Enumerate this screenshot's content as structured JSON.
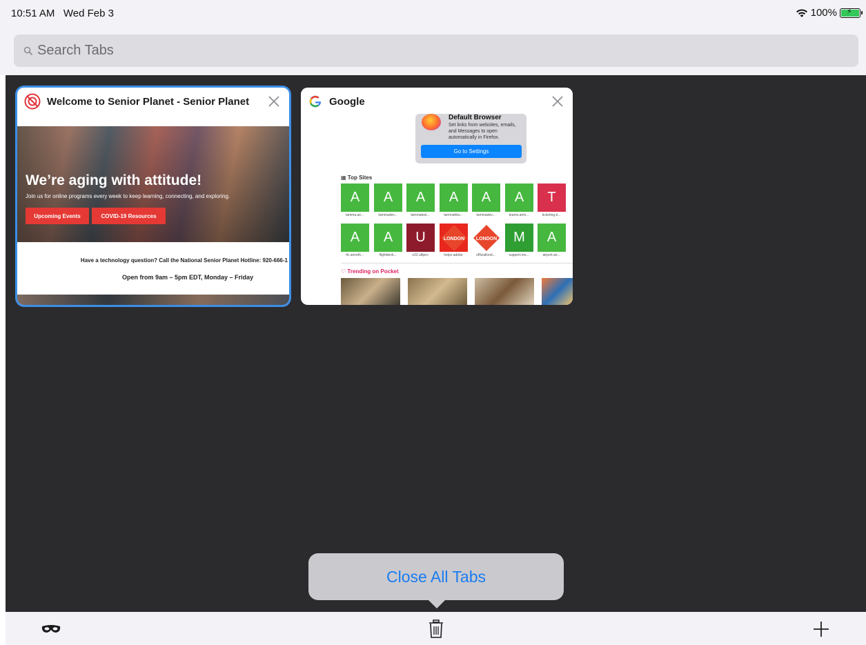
{
  "status": {
    "time": "10:51 AM",
    "date": "Wed Feb 3",
    "battery": "100%",
    "battery_level": 1.0
  },
  "search": {
    "placeholder": "Search Tabs"
  },
  "tabs": [
    {
      "title": "Welcome to Senior Planet - Senior Planet",
      "selected": true,
      "icon": "senior-planet-logo",
      "preview": {
        "headline": "We’re aging with attitude!",
        "subtitle": "Join us for online programs every week to keep learning, connecting, and exploring.",
        "button_events": "Upcoming Events",
        "button_covid": "COVID-19 Resources",
        "hotline": "Have a technology question? Call the National Senior Planet Hotline: 920-666-1",
        "hours": "Open from 9am – 5pm EDT, Monday – Friday"
      }
    },
    {
      "title": "Google",
      "selected": false,
      "icon": "google-g-logo",
      "preview": {
        "promo_title": "Default Browser",
        "promo_text": "Set links from websites, emails, and Messages to open automatically in Firefox.",
        "promo_button": "Go to Settings",
        "top_sites_label": "Top Sites",
        "top_sites": [
          {
            "letter": "A",
            "label": "tamma.air...",
            "color": "#46b83f"
          },
          {
            "letter": "A",
            "label": "tammadev...",
            "color": "#46b83f"
          },
          {
            "letter": "A",
            "label": "tammatest...",
            "color": "#46b83f"
          },
          {
            "letter": "A",
            "label": "tammahbs...",
            "color": "#46b83f"
          },
          {
            "letter": "A",
            "label": "tammadev...",
            "color": "#46b83f"
          },
          {
            "letter": "A",
            "label": "teams.airm...",
            "color": "#46b83f"
          },
          {
            "letter": "T",
            "label": "ticketing.ti...",
            "color": "#d9304e"
          },
          {
            "letter": "A",
            "label": "rfc.airneth...",
            "color": "#46b83f"
          },
          {
            "letter": "A",
            "label": "flightdeck...",
            "color": "#46b83f"
          },
          {
            "letter": "U",
            "label": "n22.ultipro",
            "color": "#8e1b2c"
          },
          {
            "letter": "",
            "label": "helpx.adobe",
            "color": "#e8281e"
          },
          {
            "letter": "",
            "label": "officiallond...",
            "color": "#ffffff"
          },
          {
            "letter": "M",
            "label": "support.mo...",
            "color": "#2f9e33"
          },
          {
            "letter": "A",
            "label": "airport.air...",
            "color": "#46b83f"
          }
        ],
        "pocket_label": "Trending on Pocket"
      }
    }
  ],
  "popover": {
    "close_all_label": "Close All Tabs"
  },
  "toolbar": {
    "private_icon": "private-mask-icon",
    "trash_icon": "trash-icon",
    "add_icon": "plus-icon"
  },
  "colors": {
    "accent": "#1a7cf0",
    "selection": "#3c8ee6",
    "tray_bg": "#2b2b2e"
  }
}
